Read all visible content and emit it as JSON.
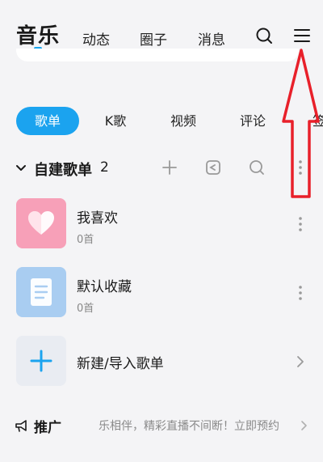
{
  "header": {
    "main_tab": "音乐",
    "tabs": [
      "动态",
      "圈子",
      "消息"
    ],
    "search_icon": "search-icon",
    "menu_icon": "hamburger-menu-icon"
  },
  "chips": [
    "歌单",
    "K歌",
    "视频",
    "评论",
    "签"
  ],
  "active_chip": "歌单",
  "section": {
    "title": "自建歌单",
    "count": "2"
  },
  "playlists": [
    {
      "title": "我喜欢",
      "subtitle": "0首",
      "cover_color": "#f7a0b8",
      "icon": "heart-icon"
    },
    {
      "title": "默认收藏",
      "subtitle": "0首",
      "cover_color": "#a9cdf1",
      "icon": "document-icon"
    }
  ],
  "create": {
    "label": "新建/导入歌单",
    "icon": "plus-icon"
  },
  "promo": {
    "title": "推广",
    "text": "乐相伴，精彩直播不间断！立即预约"
  },
  "colors": {
    "accent": "#1ba3ef",
    "annotation": "#e8202a"
  }
}
